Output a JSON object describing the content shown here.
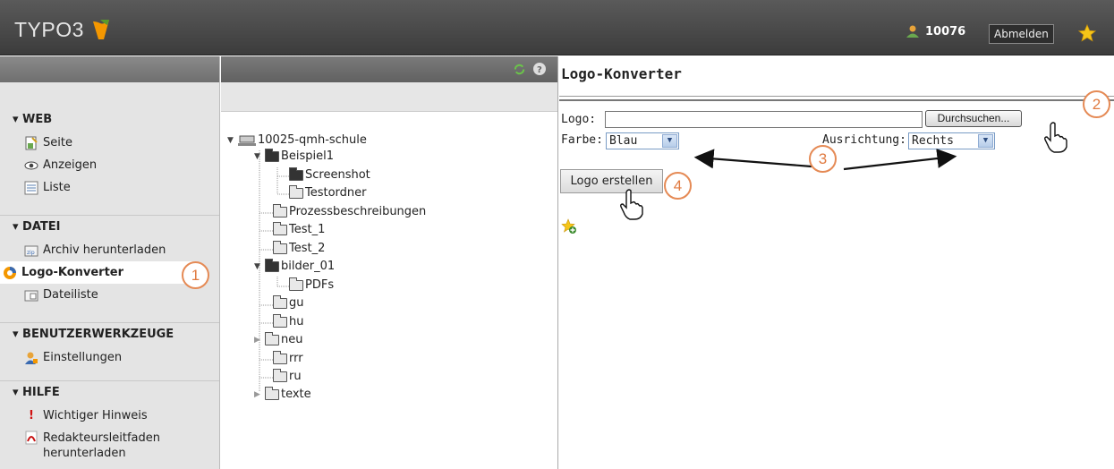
{
  "header": {
    "brand": "TYPO3",
    "user_id": "10076",
    "logout_label": "Abmelden"
  },
  "sidebar": {
    "sections": [
      {
        "title": "▾ WEB",
        "items": [
          {
            "label": "Seite",
            "icon": "page-icon"
          },
          {
            "label": "Anzeigen",
            "icon": "eye-icon"
          },
          {
            "label": "Liste",
            "icon": "list-icon"
          }
        ]
      },
      {
        "title": "▾ DATEI",
        "items": [
          {
            "label": "Archiv herunterladen",
            "icon": "zip-icon"
          },
          {
            "label": "Logo-Konverter",
            "icon": "logo-converter-icon",
            "active": true
          },
          {
            "label": "Dateiliste",
            "icon": "filelist-icon"
          }
        ]
      },
      {
        "title": "▾ BENUTZERWERKZEUGE",
        "items": [
          {
            "label": "Einstellungen",
            "icon": "user-settings-icon"
          }
        ]
      },
      {
        "title": "▾ HILFE",
        "items": [
          {
            "label": "Wichtiger Hinweis",
            "icon": "exclamation-icon"
          },
          {
            "label": "Redakteursleitfaden herunterladen",
            "icon": "pdf-icon"
          }
        ]
      }
    ]
  },
  "tree": {
    "root": "10025-qmh-schule",
    "nodes": [
      "Beispiel1",
      "Screenshot",
      "Testordner",
      "Prozessbeschreibungen",
      "Test_1",
      "Test_2",
      "bilder_01",
      "PDFs",
      "gu",
      "hu",
      "neu",
      "rrr",
      "ru",
      "texte"
    ]
  },
  "content": {
    "title": "Logo-Konverter",
    "logo_label": "Logo:",
    "browse_label": "Durchsuchen...",
    "color_label": "Farbe:",
    "color_value": "Blau",
    "align_label": "Ausrichtung:",
    "align_value": "Rechts",
    "create_label": "Logo erstellen"
  },
  "callouts": [
    "1",
    "2",
    "3",
    "4"
  ],
  "colors": {
    "accent": "#e58a55",
    "topbar": "#4a4a4a",
    "nav_bg": "#e4e4e4"
  }
}
